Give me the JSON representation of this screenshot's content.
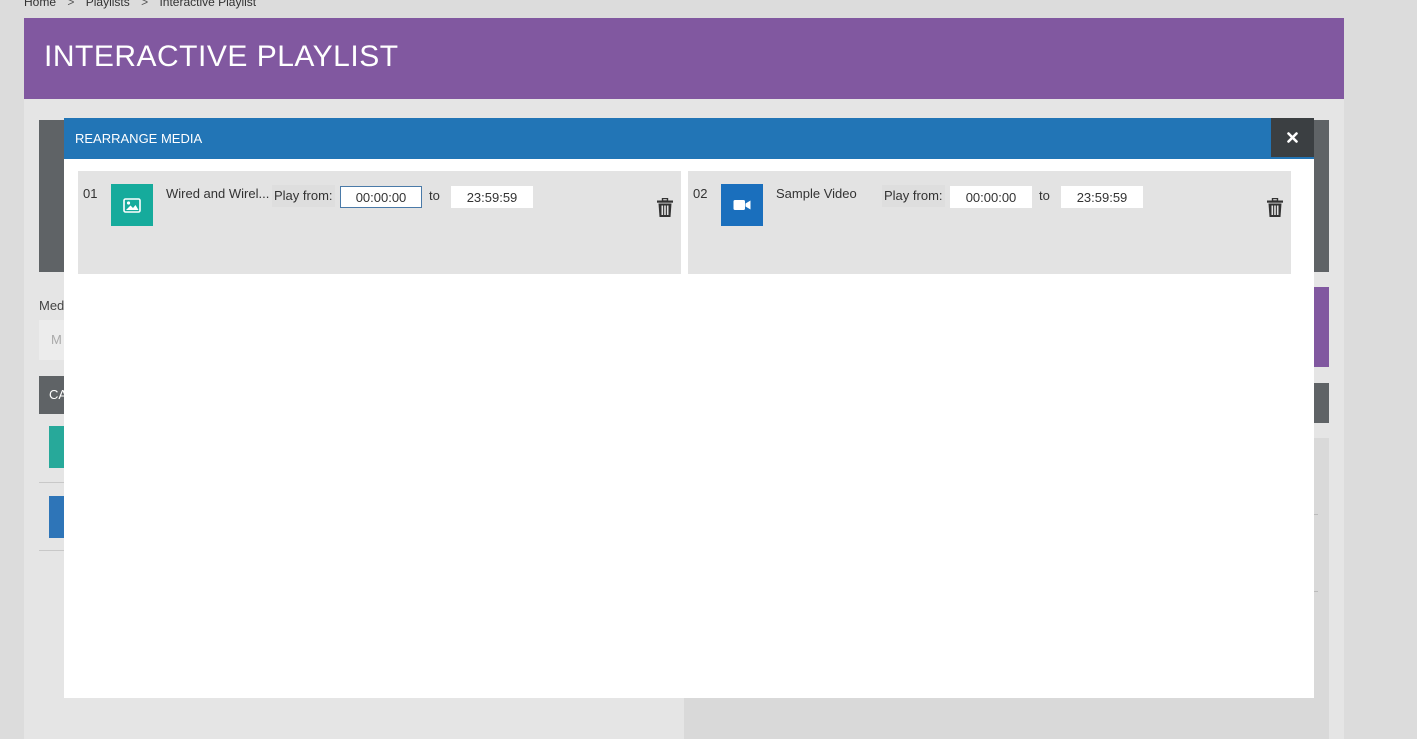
{
  "breadcrumb": {
    "home": "Home",
    "sep1": ">",
    "playlists": "Playlists",
    "sep2": ">",
    "current": "Interactive Playlist"
  },
  "page": {
    "title": "INTERACTIVE  PLAYLIST",
    "media_label": "Med",
    "media_input_placeholder": "M",
    "category_label": "CA"
  },
  "modal": {
    "title": "REARRANGE MEDIA",
    "close_icon": "close-icon",
    "items": [
      {
        "index": "01",
        "name": "Wired and Wirel...",
        "icon": "image-icon",
        "icon_color": "#16ab9c",
        "play_from_label": "Play from:",
        "from": "00:00:00",
        "to_label": "to",
        "to": "23:59:59"
      },
      {
        "index": "02",
        "name": "Sample Video",
        "icon": "video-camera-icon",
        "icon_color": "#1a6fbd",
        "play_from_label": "Play from:",
        "from": "00:00:00",
        "to_label": "to",
        "to": "23:59:59"
      }
    ]
  },
  "colors": {
    "header_purple": "#8158a0",
    "modal_blue": "#2275b6",
    "dark_gray": "#5f6366"
  }
}
